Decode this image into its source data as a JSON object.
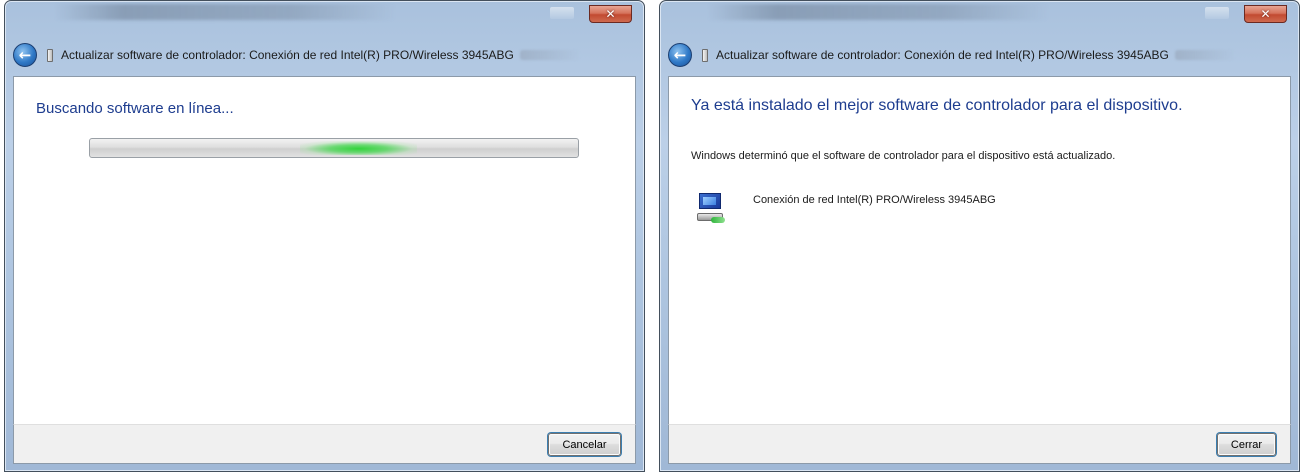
{
  "windows": [
    {
      "title": "Actualizar software de controlador: Conexión de red Intel(R) PRO/Wireless 3945ABG",
      "heading": "Buscando software en línea...",
      "button": "Cancelar",
      "progress": {
        "indeterminate": true,
        "glow_position": 0.55
      }
    },
    {
      "title": "Actualizar software de controlador: Conexión de red Intel(R) PRO/Wireless 3945ABG",
      "heading": "Ya está instalado el mejor software de controlador para el dispositivo.",
      "description": "Windows determinó que el software de controlador para el dispositivo está actualizado.",
      "device_name": "Conexión de red Intel(R) PRO/Wireless 3945ABG",
      "button": "Cerrar"
    }
  ],
  "icons": {
    "back": "back-arrow-icon",
    "close": "close-icon",
    "device": "device-icon",
    "network_adapter": "network-adapter-icon"
  },
  "colors": {
    "heading": "#1e3d8f",
    "close_button": "#c24a31",
    "progress_glow": "#33d43c",
    "frame": "#aec5e0"
  }
}
